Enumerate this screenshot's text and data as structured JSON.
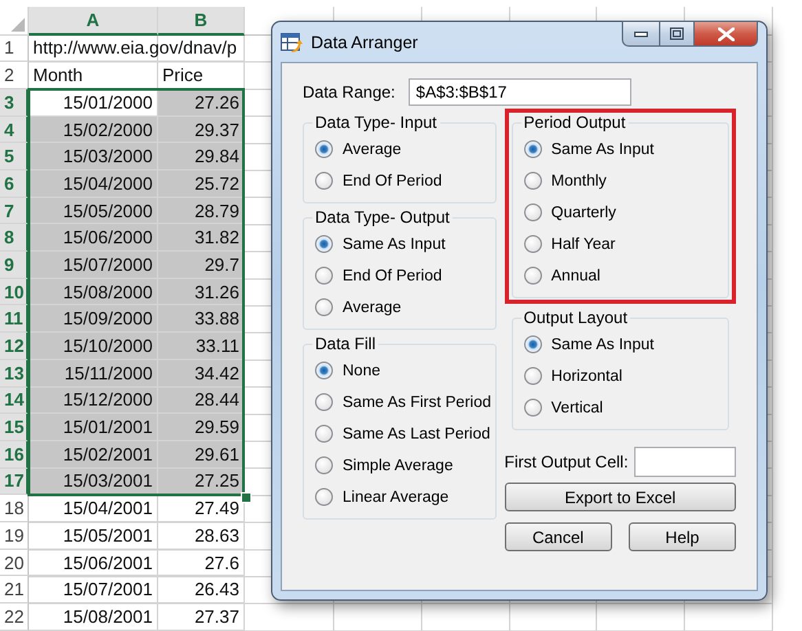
{
  "sheet": {
    "columns": [
      {
        "label": "A",
        "selected": true
      },
      {
        "label": "B",
        "selected": true
      }
    ],
    "rows": [
      {
        "number": "1",
        "kind": "text",
        "selected": false,
        "cells": [
          "http://www.eia.gov/dnav/p"
        ]
      },
      {
        "number": "2",
        "kind": "text",
        "selected": false,
        "cells": [
          "Month",
          "Price"
        ]
      },
      {
        "number": "3",
        "kind": "number",
        "selected": true,
        "cells": [
          "15/01/2000",
          "27.26"
        ]
      },
      {
        "number": "4",
        "kind": "number",
        "selected": true,
        "cells": [
          "15/02/2000",
          "29.37"
        ]
      },
      {
        "number": "5",
        "kind": "number",
        "selected": true,
        "cells": [
          "15/03/2000",
          "29.84"
        ]
      },
      {
        "number": "6",
        "kind": "number",
        "selected": true,
        "cells": [
          "15/04/2000",
          "25.72"
        ]
      },
      {
        "number": "7",
        "kind": "number",
        "selected": true,
        "cells": [
          "15/05/2000",
          "28.79"
        ]
      },
      {
        "number": "8",
        "kind": "number",
        "selected": true,
        "cells": [
          "15/06/2000",
          "31.82"
        ]
      },
      {
        "number": "9",
        "kind": "number",
        "selected": true,
        "cells": [
          "15/07/2000",
          "29.7"
        ]
      },
      {
        "number": "10",
        "kind": "number",
        "selected": true,
        "cells": [
          "15/08/2000",
          "31.26"
        ]
      },
      {
        "number": "11",
        "kind": "number",
        "selected": true,
        "cells": [
          "15/09/2000",
          "33.88"
        ]
      },
      {
        "number": "12",
        "kind": "number",
        "selected": true,
        "cells": [
          "15/10/2000",
          "33.11"
        ]
      },
      {
        "number": "13",
        "kind": "number",
        "selected": true,
        "cells": [
          "15/11/2000",
          "34.42"
        ]
      },
      {
        "number": "14",
        "kind": "number",
        "selected": true,
        "cells": [
          "15/12/2000",
          "28.44"
        ]
      },
      {
        "number": "15",
        "kind": "number",
        "selected": true,
        "cells": [
          "15/01/2001",
          "29.59"
        ]
      },
      {
        "number": "16",
        "kind": "number",
        "selected": true,
        "cells": [
          "15/02/2001",
          "29.61"
        ]
      },
      {
        "number": "17",
        "kind": "number",
        "selected": true,
        "cells": [
          "15/03/2001",
          "27.25"
        ]
      },
      {
        "number": "18",
        "kind": "number",
        "selected": false,
        "cells": [
          "15/04/2001",
          "27.49"
        ]
      },
      {
        "number": "19",
        "kind": "number",
        "selected": false,
        "cells": [
          "15/05/2001",
          "28.63"
        ]
      },
      {
        "number": "20",
        "kind": "number",
        "selected": false,
        "cells": [
          "15/06/2001",
          "27.6"
        ]
      },
      {
        "number": "21",
        "kind": "number",
        "selected": false,
        "cells": [
          "15/07/2001",
          "26.43"
        ]
      },
      {
        "number": "22",
        "kind": "number",
        "selected": false,
        "cells": [
          "15/08/2001",
          "27.37"
        ]
      }
    ]
  },
  "window": {
    "title": "Data Arranger"
  },
  "data_range": {
    "label": "Data Range:",
    "value": "$A$3:$B$17"
  },
  "left_groups": [
    {
      "title": "Data Type- Input",
      "highlighted": false,
      "options": [
        {
          "label": "Average",
          "selected": true
        },
        {
          "label": "End Of Period",
          "selected": false
        }
      ]
    },
    {
      "title": "Data Type- Output",
      "highlighted": false,
      "options": [
        {
          "label": "Same As Input",
          "selected": true
        },
        {
          "label": "End Of Period",
          "selected": false
        },
        {
          "label": "Average",
          "selected": false
        }
      ]
    },
    {
      "title": "Data Fill",
      "highlighted": false,
      "options": [
        {
          "label": "None",
          "selected": true
        },
        {
          "label": "Same As First Period",
          "selected": false
        },
        {
          "label": "Same As Last Period",
          "selected": false
        },
        {
          "label": "Simple Average",
          "selected": false
        },
        {
          "label": "Linear Average",
          "selected": false
        }
      ]
    }
  ],
  "right_groups": [
    {
      "title": "Period Output",
      "highlighted": true,
      "options": [
        {
          "label": "Same As Input",
          "selected": true
        },
        {
          "label": "Monthly",
          "selected": false
        },
        {
          "label": "Quarterly",
          "selected": false
        },
        {
          "label": "Half Year",
          "selected": false
        },
        {
          "label": "Annual",
          "selected": false
        }
      ]
    },
    {
      "title": "Output Layout",
      "highlighted": false,
      "options": [
        {
          "label": "Same As Input",
          "selected": true
        },
        {
          "label": "Horizontal",
          "selected": false
        },
        {
          "label": "Vertical",
          "selected": false
        }
      ]
    }
  ],
  "first_output_cell": {
    "label": "First Output Cell:"
  },
  "buttons": [
    "Export to Excel",
    "Cancel",
    "Help"
  ]
}
